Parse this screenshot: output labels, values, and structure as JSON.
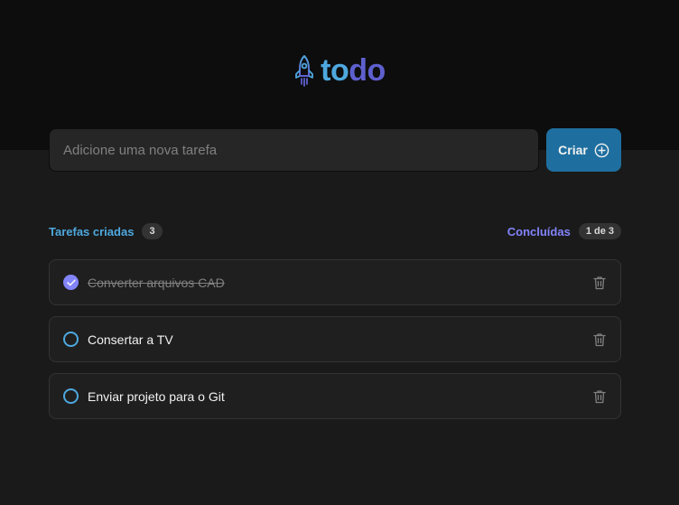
{
  "header": {
    "logo_text_part1": "to",
    "logo_text_part2": "do",
    "logo_icon": "rocket-icon"
  },
  "new_task": {
    "placeholder": "Adicione uma nova tarefa",
    "value": "",
    "create_label": "Criar",
    "create_icon": "plus-circle-icon"
  },
  "counters": {
    "created_label": "Tarefas criadas",
    "created_count": "3",
    "done_label": "Concluídas",
    "done_count": "1 de 3"
  },
  "tasks": [
    {
      "text": "Converter arquivos CAD",
      "completed": true
    },
    {
      "text": "Consertar a TV",
      "completed": false
    },
    {
      "text": "Enviar projeto para o Git",
      "completed": false
    }
  ],
  "colors": {
    "blue": "#4ea8de",
    "purple": "#5e60ce",
    "purple_light": "#8284fa",
    "button": "#1e6f9f"
  }
}
